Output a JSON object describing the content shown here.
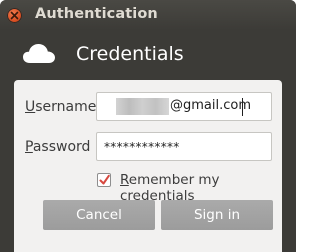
{
  "window": {
    "title": "Authentication",
    "close_icon": "close-icon"
  },
  "header": {
    "icon": "cloud-icon",
    "title": "Credentials"
  },
  "form": {
    "username_label_accesskey": "U",
    "username_label_rest": "sername",
    "username_value_visible": "@gmail.com",
    "password_label_accesskey": "P",
    "password_label_rest": "assword",
    "password_value": "************",
    "remember_accesskey": "R",
    "remember_rest": "emember my credentials",
    "remember_checked": true
  },
  "buttons": {
    "cancel_label": "Cancel",
    "signin_label": "Sign in"
  },
  "colors": {
    "window_bg": "#3c3b37",
    "content_bg": "#f2f1f0",
    "close_button": "#e05a24",
    "checkmark": "#d7483f",
    "button_bg": "#a3a3a3"
  }
}
